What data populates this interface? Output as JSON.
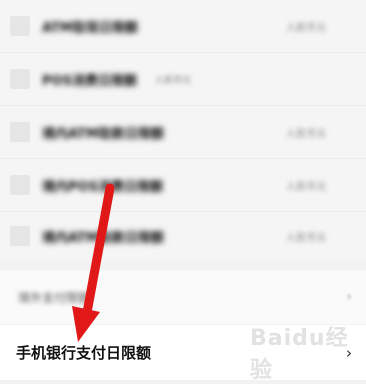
{
  "blurred_rows": [
    {
      "label": "ATM取现日限额",
      "hint": "",
      "value": "人民币元"
    },
    {
      "label": "POS消费日限额",
      "hint": "人民币元",
      "value": ""
    },
    {
      "label": "境内ATM取款日限额",
      "hint": "",
      "value": "人民币元"
    },
    {
      "label": "境内POS消费日限额",
      "hint": "",
      "value": "人民币元"
    },
    {
      "label": "境内ATM取款日限额",
      "hint": "",
      "value": "人民币元"
    }
  ],
  "section": {
    "label": "境外支付限额"
  },
  "main_item": {
    "label": "手机银行支付日限额",
    "chevron": "›"
  },
  "watermark": {
    "text": "Baidu经验"
  },
  "annotation": {
    "color": "#e01818"
  }
}
